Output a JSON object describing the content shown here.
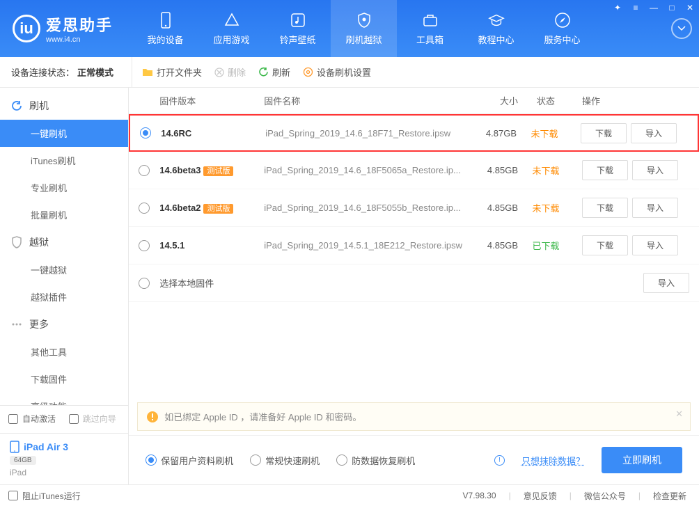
{
  "logo": {
    "title": "爱思助手",
    "sub": "www.i4.cn"
  },
  "nav": {
    "items": [
      {
        "label": "我的设备"
      },
      {
        "label": "应用游戏"
      },
      {
        "label": "铃声壁纸"
      },
      {
        "label": "刷机越狱"
      },
      {
        "label": "工具箱"
      },
      {
        "label": "教程中心"
      },
      {
        "label": "服务中心"
      }
    ]
  },
  "status": {
    "label": "设备连接状态：",
    "value": "正常模式"
  },
  "toolbar": {
    "open": "打开文件夹",
    "delete": "删除",
    "refresh": "刷新",
    "settings": "设备刷机设置"
  },
  "sidebar": {
    "flash": "刷机",
    "oneKeyFlash": "一键刷机",
    "itunesFlash": "iTunes刷机",
    "proFlash": "专业刷机",
    "batchFlash": "批量刷机",
    "jailbreak": "越狱",
    "oneKeyJailbreak": "一键越狱",
    "jailbreakPlugin": "越狱插件",
    "more": "更多",
    "otherTools": "其他工具",
    "downloadFirmware": "下载固件",
    "advanced": "高级功能",
    "autoActivate": "自动激活",
    "skipGuide": "跳过向导"
  },
  "device": {
    "name": "iPad Air 3",
    "storage": "64GB",
    "type": "iPad"
  },
  "table": {
    "headers": {
      "version": "固件版本",
      "name": "固件名称",
      "size": "大小",
      "status": "状态",
      "action": "操作"
    },
    "rows": [
      {
        "version": "14.6RC",
        "badge": "",
        "name": "iPad_Spring_2019_14.6_18F71_Restore.ipsw",
        "size": "4.87GB",
        "status": "未下载",
        "statusClass": "orange",
        "checked": true,
        "hl": true
      },
      {
        "version": "14.6beta3",
        "badge": "测试版",
        "name": "iPad_Spring_2019_14.6_18F5065a_Restore.ip...",
        "size": "4.85GB",
        "status": "未下载",
        "statusClass": "orange",
        "checked": false,
        "hl": false
      },
      {
        "version": "14.6beta2",
        "badge": "测试版",
        "name": "iPad_Spring_2019_14.6_18F5055b_Restore.ip...",
        "size": "4.85GB",
        "status": "未下载",
        "statusClass": "orange",
        "checked": false,
        "hl": false
      },
      {
        "version": "14.5.1",
        "badge": "",
        "name": "iPad_Spring_2019_14.5.1_18E212_Restore.ipsw",
        "size": "4.85GB",
        "status": "已下载",
        "statusClass": "green",
        "checked": false,
        "hl": false
      }
    ],
    "localRow": "选择本地固件",
    "btnDownload": "下载",
    "btnImport": "导入"
  },
  "notice": "如已绑定 Apple ID ，请准备好 Apple ID 和密码。",
  "options": {
    "keepData": "保留用户资料刷机",
    "normalFast": "常规快速刷机",
    "antiLoss": "防数据恢复刷机",
    "eraseLink": "只想抹除数据？",
    "flashNow": "立即刷机"
  },
  "footer": {
    "blockItunes": "阻止iTunes运行",
    "version": "V7.98.30",
    "feedback": "意见反馈",
    "wechat": "微信公众号",
    "update": "检查更新"
  }
}
